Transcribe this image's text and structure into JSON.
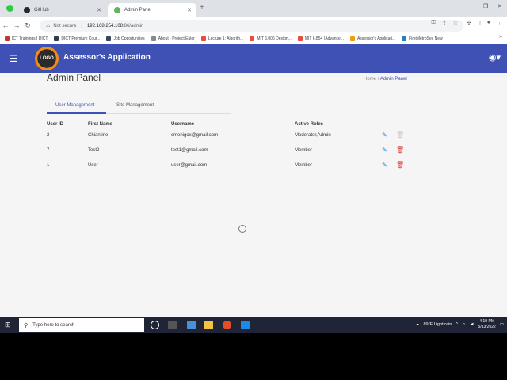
{
  "browser": {
    "tabs": [
      {
        "title": "GitHub",
        "favicon_color": "#24292e"
      },
      {
        "title": "Admin Panel",
        "favicon_color": "#5cb85c"
      }
    ],
    "security_label": "Not secure",
    "url_host": "192.168.254.108",
    "url_path": ":86/admin",
    "bookmarks": [
      {
        "label": "ICT Trainings | DICT",
        "color": "#c0392b"
      },
      {
        "label": "DICT Premium Cour...",
        "color": "#2c3e50"
      },
      {
        "label": "Job Opportunities",
        "color": "#34495e"
      },
      {
        "label": "About - Project Euler",
        "color": "#7f8c8d"
      },
      {
        "label": "Lecture 1: Algorith...",
        "color": "#e74c3c"
      },
      {
        "label": "MIT 6.006 Design...",
        "color": "#e74c3c"
      },
      {
        "label": "MIT 6.854 (Advance...",
        "color": "#e74c3c"
      },
      {
        "label": "Assessor's Applicati...",
        "color": "#f39c12"
      },
      {
        "label": "FirstMetroSec New",
        "color": "#2980b9"
      }
    ]
  },
  "app": {
    "logo_text": "LOGO",
    "title": "Assessor's Application",
    "accent": "#3f51b5"
  },
  "page": {
    "title": "Admin Panel",
    "breadcrumb_home": "Home",
    "breadcrumb_sep": "/",
    "breadcrumb_current": "Admin Panel"
  },
  "tabs": {
    "user_management": "User Management",
    "site_management": "Site Management"
  },
  "table": {
    "headers": {
      "id": "User ID",
      "first": "First Name",
      "username": "Username",
      "roles": "Active Roles"
    },
    "rows": [
      {
        "id": "2",
        "first": "Chiantine",
        "username": "cmenigox@gmail.com",
        "roles": "Moderator,Admin",
        "delete_enabled": false
      },
      {
        "id": "7",
        "first": "Test2",
        "username": "test1@gmail.com",
        "roles": "Member",
        "delete_enabled": true
      },
      {
        "id": "1",
        "first": "User",
        "username": "user@gmail.com",
        "roles": "Member",
        "delete_enabled": true
      }
    ]
  },
  "taskbar": {
    "search_placeholder": "Type here to search",
    "weather": "89°F  Light rain",
    "time": "4:19 PM",
    "date": "5/13/2022"
  }
}
